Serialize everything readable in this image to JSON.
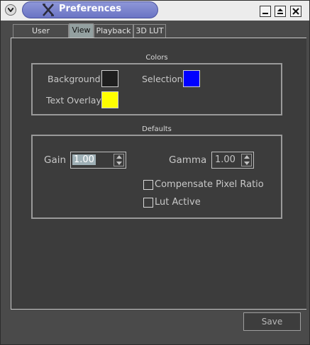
{
  "window": {
    "title": "Preferences"
  },
  "tabs": [
    {
      "label": "User Interface",
      "active": false
    },
    {
      "label": "View",
      "active": true
    },
    {
      "label": "Playback",
      "active": false
    },
    {
      "label": "3D LUT",
      "active": false
    }
  ],
  "colors": {
    "group_label": "Colors",
    "background_label": "Background",
    "background_color": "#1e1e1e",
    "selection_label": "Selection",
    "selection_color": "#0000ff",
    "text_overlay_label": "Text Overlay",
    "text_overlay_color": "#ffff00"
  },
  "defaults": {
    "group_label": "Defaults",
    "gain_label": "Gain",
    "gain_value": "1.00",
    "gamma_label": "Gamma",
    "gamma_value": "1.00",
    "compensate_label": "Compensate Pixel Ratio",
    "compensate_checked": false,
    "lut_label": "Lut Active",
    "lut_checked": false
  },
  "save_label": "Save"
}
